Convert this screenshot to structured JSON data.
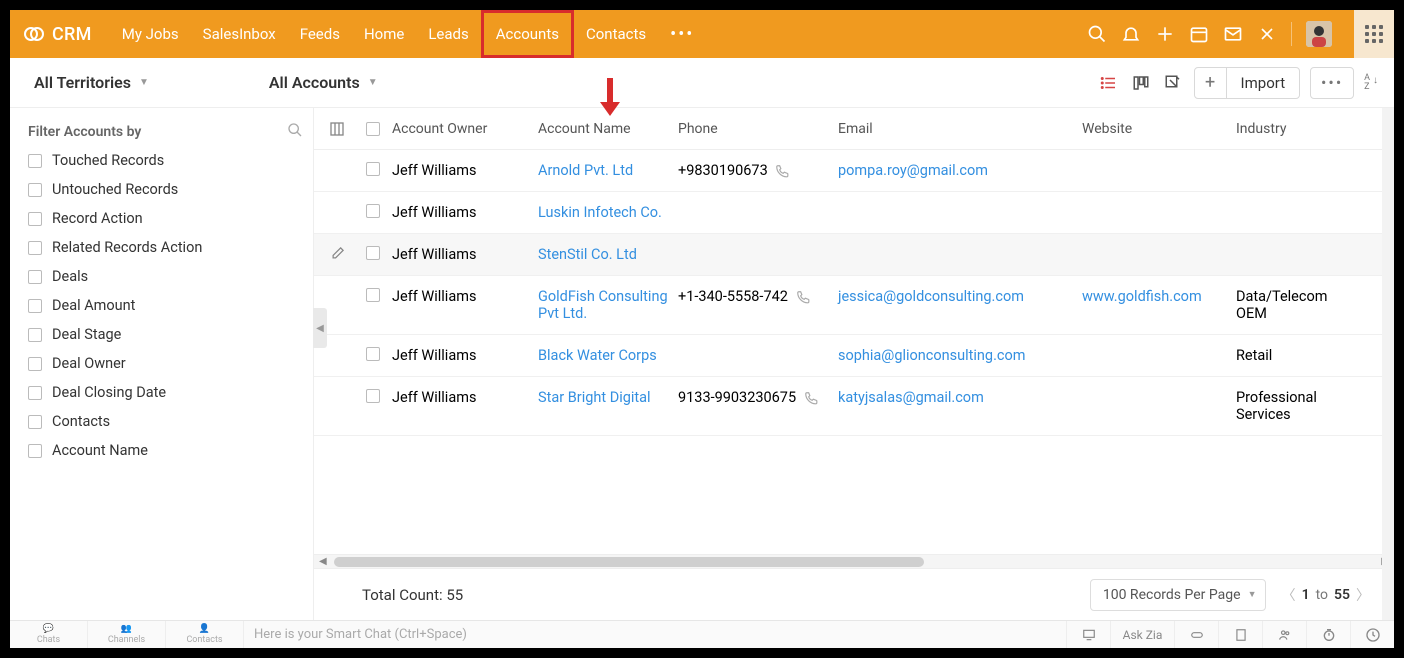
{
  "brand": "CRM",
  "nav": {
    "items": [
      "My Jobs",
      "SalesInbox",
      "Feeds",
      "Home",
      "Leads",
      "Accounts",
      "Contacts"
    ],
    "active": "Accounts"
  },
  "toolbar": {
    "territories": "All Territories",
    "view": "All Accounts",
    "import": "Import"
  },
  "sidebar": {
    "title": "Filter Accounts by",
    "filters": [
      "Touched Records",
      "Untouched Records",
      "Record Action",
      "Related Records Action",
      "Deals",
      "Deal Amount",
      "Deal Stage",
      "Deal Owner",
      "Deal Closing Date",
      "Contacts",
      "Account Name"
    ]
  },
  "table": {
    "headers": {
      "owner": "Account Owner",
      "name": "Account Name",
      "phone": "Phone",
      "email": "Email",
      "website": "Website",
      "industry": "Industry"
    },
    "rows": [
      {
        "owner": "Jeff Williams",
        "name": "Arnold Pvt. Ltd",
        "phone": "+9830190673",
        "email": "pompa.roy@gmail.com",
        "website": "",
        "industry": ""
      },
      {
        "owner": "Jeff Williams",
        "name": "Luskin Infotech Co.",
        "phone": "",
        "email": "",
        "website": "",
        "industry": ""
      },
      {
        "owner": "Jeff Williams",
        "name": "StenStil Co. Ltd",
        "phone": "",
        "email": "",
        "website": "",
        "industry": "",
        "hover": true
      },
      {
        "owner": "Jeff Williams",
        "name": "GoldFish Consulting Pvt Ltd.",
        "phone": "+1-340-5558-742",
        "email": "jessica@goldconsulting.com",
        "website": "www.goldfish.com",
        "industry": "Data/Telecom OEM"
      },
      {
        "owner": "Jeff Williams",
        "name": "Black Water Corps",
        "phone": "",
        "email": "sophia@glionconsulting.com",
        "website": "",
        "industry": "Retail"
      },
      {
        "owner": "Jeff Williams",
        "name": "Star Bright Digital",
        "phone": "9133-9903230675",
        "email": "katyjsalas@gmail.com",
        "website": "",
        "industry": "Professional Services"
      }
    ],
    "total_label": "Total Count: 55",
    "per_page": "100 Records Per Page",
    "pager": {
      "from": "1",
      "to_word": "to",
      "to": "55"
    }
  },
  "bottom": {
    "tabs": [
      "Chats",
      "Channels",
      "Contacts"
    ],
    "smart_chat": "Here is your Smart Chat (Ctrl+Space)",
    "ask": "Ask Zia"
  }
}
